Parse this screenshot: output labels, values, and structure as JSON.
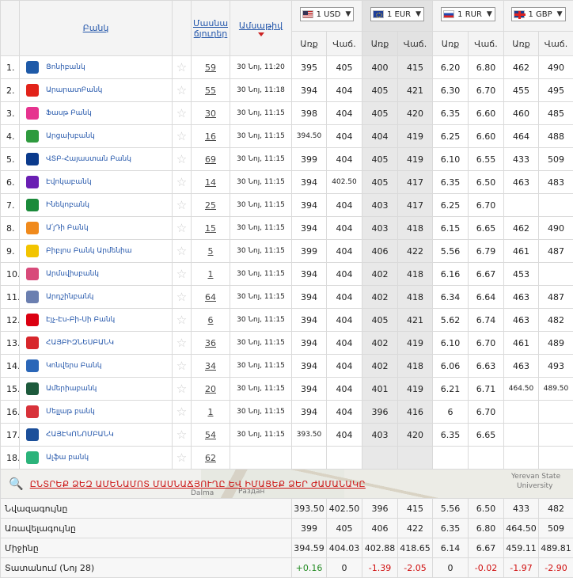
{
  "header": {
    "bank_col": "Բանկ",
    "votes_col": "Մասնաճյուղեր",
    "votes_col_line1": "Մասնա",
    "votes_col_line2": "ճյուղեր",
    "date_col": "Ամսաթիվ",
    "currencies": [
      {
        "label": "1 USD",
        "flag": "us-flag-icon"
      },
      {
        "label": "1 EUR",
        "flag": "eu-flag-icon"
      },
      {
        "label": "1 RUR",
        "flag": "ru-flag-icon"
      },
      {
        "label": "1 GBP",
        "flag": "gb-flag-icon"
      }
    ],
    "buy": "Առք",
    "sell": "Վաճ."
  },
  "banks": [
    {
      "n": "1.",
      "name": "Ցոնիբանկ",
      "votes": "59",
      "date": "30 Նոյ, 11:20",
      "r": [
        "395",
        "405",
        "400",
        "415",
        "6.20",
        "6.80",
        "462",
        "490"
      ],
      "color": "#1e5aa8"
    },
    {
      "n": "2.",
      "name": "ԱրարատԲանկ",
      "votes": "55",
      "date": "30 Նոյ, 11:18",
      "r": [
        "394",
        "404",
        "405",
        "421",
        "6.30",
        "6.70",
        "455",
        "495"
      ],
      "color": "#e2231a"
    },
    {
      "n": "3.",
      "name": "Ֆասթ Բանկ",
      "votes": "30",
      "date": "30 Նոյ, 11:15",
      "r": [
        "398",
        "404",
        "405",
        "420",
        "6.35",
        "6.60",
        "460",
        "485"
      ],
      "color": "#e6338f"
    },
    {
      "n": "4.",
      "name": "Արցախբանկ",
      "votes": "16",
      "date": "30 Նոյ, 11:15",
      "r": [
        "394.50",
        "404",
        "404",
        "419",
        "6.25",
        "6.60",
        "464",
        "488"
      ],
      "color": "#2e9a3e"
    },
    {
      "n": "5.",
      "name": "ՎՏԲ-Հայաստան Բանկ",
      "votes": "69",
      "date": "30 Նոյ, 11:15",
      "r": [
        "399",
        "404",
        "405",
        "419",
        "6.10",
        "6.55",
        "433",
        "509"
      ],
      "color": "#0b3a8c"
    },
    {
      "n": "6.",
      "name": "Էվոկաբանկ",
      "votes": "14",
      "date": "30 Նոյ, 11:15",
      "r": [
        "394",
        "402.50",
        "405",
        "417",
        "6.35",
        "6.50",
        "463",
        "483"
      ],
      "color": "#6a1fb3"
    },
    {
      "n": "7.",
      "name": "Ինեկոբանկ",
      "votes": "25",
      "date": "30 Նոյ, 11:15",
      "r": [
        "394",
        "404",
        "403",
        "417",
        "6.25",
        "6.70",
        "",
        ""
      ],
      "color": "#1a8a3a"
    },
    {
      "n": "8.",
      "name": "Ա՛յԴի Բանկ",
      "votes": "15",
      "date": "30 Նոյ, 11:15",
      "r": [
        "394",
        "404",
        "403",
        "418",
        "6.15",
        "6.65",
        "462",
        "490"
      ],
      "color": "#f08a1c"
    },
    {
      "n": "9.",
      "name": "Բիբլոս Բանկ Արմենիա",
      "votes": "5",
      "date": "30 Նոյ, 11:15",
      "r": [
        "399",
        "404",
        "406",
        "422",
        "5.56",
        "6.79",
        "461",
        "487"
      ],
      "color": "#f2c400"
    },
    {
      "n": "10.",
      "name": "Արմսվիսբանկ",
      "votes": "1",
      "date": "30 Նոյ, 11:15",
      "r": [
        "394",
        "404",
        "402",
        "418",
        "6.16",
        "6.67",
        "453",
        ""
      ],
      "color": "#d84a7a"
    },
    {
      "n": "11.",
      "name": "Արդշինբանկ",
      "votes": "64",
      "date": "30 Նոյ, 11:15",
      "r": [
        "394",
        "404",
        "402",
        "418",
        "6.34",
        "6.64",
        "463",
        "487"
      ],
      "color": "#6b7fb0"
    },
    {
      "n": "12.",
      "name": "Էյչ-Էս-Բի-Սի Բանկ",
      "votes": "6",
      "date": "30 Նոյ, 11:15",
      "r": [
        "394",
        "404",
        "405",
        "421",
        "5.62",
        "6.74",
        "463",
        "482"
      ],
      "color": "#db0011"
    },
    {
      "n": "13.",
      "name": "ՀԱՅԲԻԶՆԵՍԲԱՆԿ",
      "votes": "36",
      "date": "30 Նոյ, 11:15",
      "r": [
        "394",
        "404",
        "402",
        "419",
        "6.10",
        "6.70",
        "461",
        "489"
      ],
      "color": "#d7262b"
    },
    {
      "n": "14.",
      "name": "Կոնվերս Բանկ",
      "votes": "34",
      "date": "30 Նոյ, 11:15",
      "r": [
        "394",
        "404",
        "402",
        "418",
        "6.06",
        "6.63",
        "463",
        "493"
      ],
      "color": "#2a66b8"
    },
    {
      "n": "15.",
      "name": "Ամերիաբանկ",
      "votes": "20",
      "date": "30 Նոյ, 11:15",
      "r": [
        "394",
        "404",
        "401",
        "419",
        "6.21",
        "6.71",
        "464.50",
        "489.50"
      ],
      "color": "#1d5a3c"
    },
    {
      "n": "16.",
      "name": "Մելլաթ բանկ",
      "votes": "1",
      "date": "30 Նոյ, 11:15",
      "r": [
        "394",
        "404",
        "396",
        "416",
        "6",
        "6.70",
        "",
        ""
      ],
      "color": "#d8323a"
    },
    {
      "n": "17.",
      "name": "ՀԱՅԷԿՈՆՈՄԲԱՆԿ",
      "votes": "54",
      "date": "30 Նոյ, 11:15",
      "r": [
        "393.50",
        "404",
        "403",
        "420",
        "6.35",
        "6.65",
        "",
        ""
      ],
      "color": "#1b4f9a"
    },
    {
      "n": "18.",
      "name": "Ալֆա բանկ",
      "votes": "62",
      "date": "",
      "r": [
        "",
        "",
        "",
        "",
        "",
        "",
        "",
        ""
      ],
      "color": "#2bb37a"
    }
  ],
  "search": {
    "text": "ԸՆՏՐԵՔ ՁԵԶ ԱՄԵՆԱՄՈՏ ՄԱՍՆԱՃՅՈՒՂԸ ԵՎ ԻՄԱՑԵՔ ՁԵՐ ԺԱՄԱՆԱԿԸ",
    "map_label_1": "Yerevan State",
    "map_label_2": "University",
    "map_label_3": "Раздан",
    "map_label_4": "Dalma"
  },
  "summary": [
    {
      "label": "Նվազագույնը",
      "r": [
        "393.50",
        "402.50",
        "396",
        "415",
        "5.56",
        "6.50",
        "433",
        "482"
      ]
    },
    {
      "label": "Առավելագույնը",
      "r": [
        "399",
        "405",
        "406",
        "422",
        "6.35",
        "6.80",
        "464.50",
        "509"
      ]
    },
    {
      "label": "Միջինը",
      "r": [
        "394.59",
        "404.03",
        "402.88",
        "418.65",
        "6.14",
        "6.67",
        "459.11",
        "489.81"
      ]
    },
    {
      "label": "Տատանում (Նոյ 28)",
      "r": [
        "+0.16",
        "0",
        "-1.39",
        "-2.05",
        "0",
        "-0.02",
        "-1.97",
        "-2.90"
      ]
    }
  ]
}
